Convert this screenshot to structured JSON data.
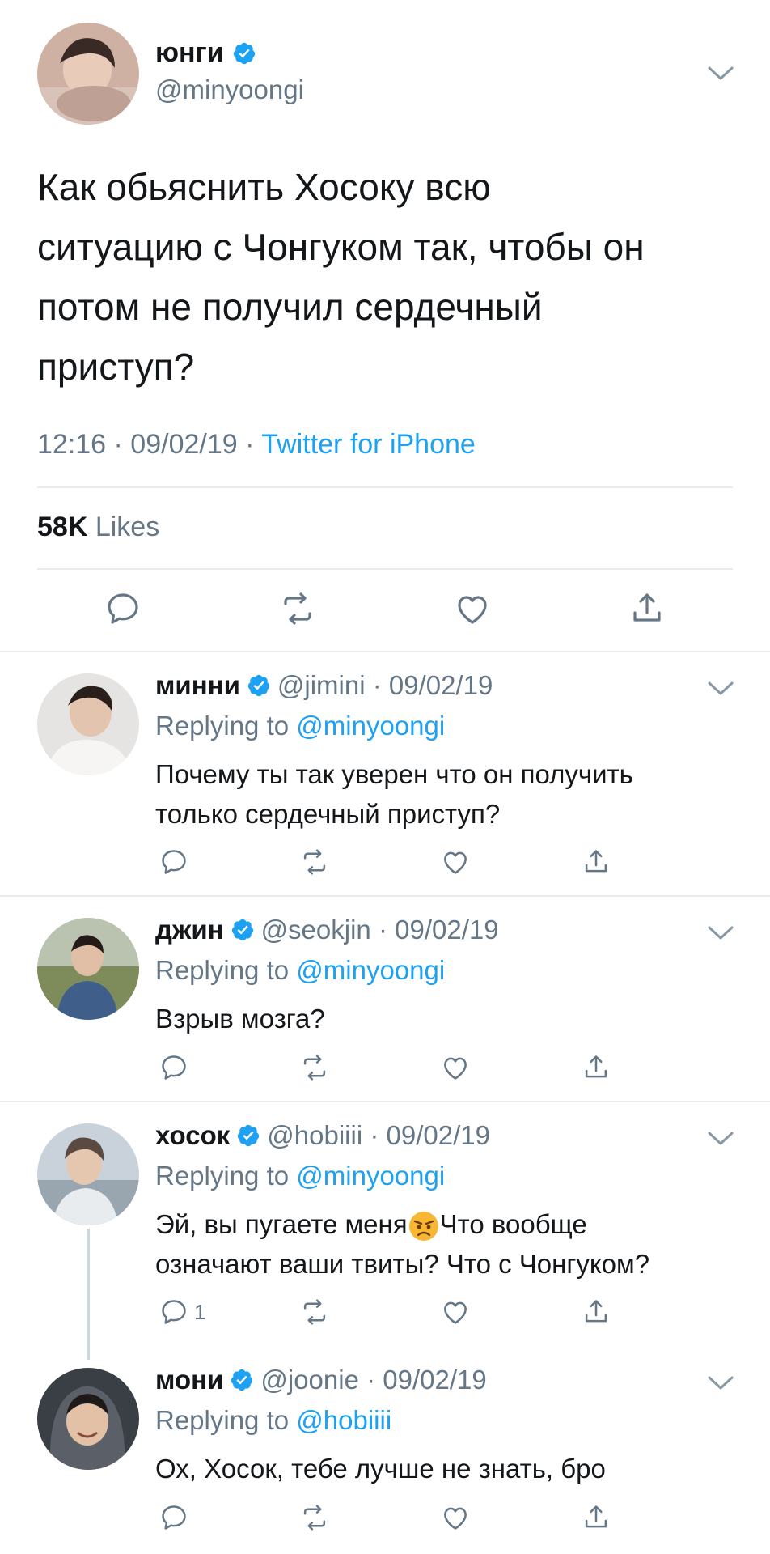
{
  "main_tweet": {
    "name": "юнги",
    "handle": "@minyoongi",
    "text_lines": [
      "Как обьяснить Хосоку всю",
      "ситуацию с Чонгуком так, чтобы он",
      "потом не получил сердечный",
      "приступ?"
    ],
    "time": "12:16 · 09/02/19 · ",
    "source": "Twitter for iPhone",
    "likes_count": "58K",
    "likes_label": "Likes"
  },
  "replies": [
    {
      "name": "минни",
      "handle": "@jimini · 09/02/19",
      "replying_label": "Replying to",
      "replying_to": "@minyoongi",
      "text_lines": [
        "Почему ты так уверен что он получить",
        "только сердечный приступ?"
      ],
      "reply_count": ""
    },
    {
      "name": "джин",
      "handle": "@seokjin · 09/02/19",
      "replying_label": "Replying to",
      "replying_to": "@minyoongi",
      "text_lines": [
        "Взрыв мозга?"
      ],
      "reply_count": ""
    },
    {
      "name": "хосок",
      "handle": "@hobiiii · 09/02/19",
      "replying_label": "Replying to",
      "replying_to": "@minyoongi",
      "text_line1_a": "Эй, вы пугаете меня",
      "text_line1_b": "Что вообще",
      "text_line2": "означают ваши твиты? Что с Чонгуком?",
      "reply_count": "1"
    },
    {
      "name": "мони",
      "handle": "@joonie · 09/02/19",
      "replying_label": "Replying to",
      "replying_to": "@hobiiii",
      "text_lines": [
        "Ох, Хосок, тебе лучше не знать, бро"
      ],
      "reply_count": ""
    }
  ],
  "colors": {
    "accent": "#1da1f2",
    "secondary_text": "#657786",
    "icon_gray": "#657786",
    "divider": "#e6ecf0"
  }
}
